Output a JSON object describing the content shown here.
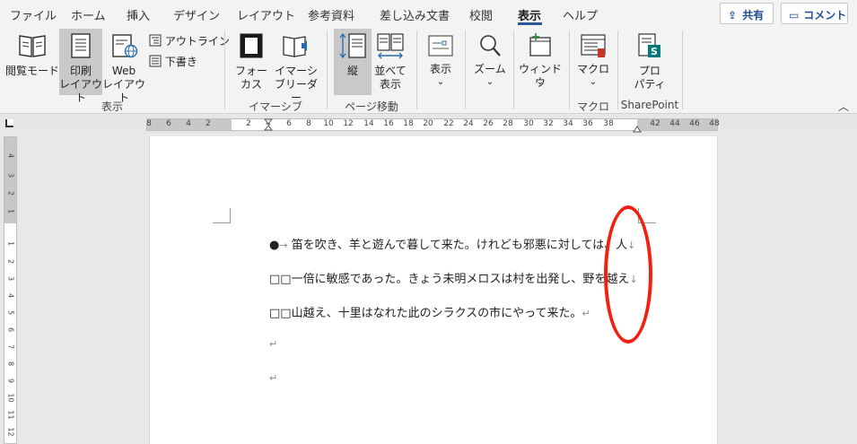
{
  "menu": {
    "tabs": [
      "ファイル",
      "ホーム",
      "挿入",
      "デザイン",
      "レイアウト",
      "参考資料",
      "差し込み文書",
      "校閲",
      "表示",
      "ヘルプ"
    ],
    "active_tab": "表示",
    "share_label": "共有",
    "comment_label": "コメント"
  },
  "ribbon": {
    "views": {
      "read_mode": "閲覧モード",
      "print_layout_1": "印刷",
      "print_layout_2": "レイアウト",
      "web_layout_1": "Web",
      "web_layout_2": "レイアウト",
      "outline": "アウトライン",
      "draft": "下書き",
      "group_label": "表示"
    },
    "immersive": {
      "focus_1": "フォー",
      "focus_2": "カス",
      "reader_1": "イマーシ",
      "reader_2": "ブリーダー",
      "group_label": "イマーシブ"
    },
    "page_movement": {
      "vertical": "縦",
      "side_1": "並べて",
      "side_2": "表示",
      "group_label": "ページ移動"
    },
    "show": {
      "label": "表示"
    },
    "zoom": {
      "label": "ズーム"
    },
    "window": {
      "label": "ウィンドウ"
    },
    "macro": {
      "label": "マクロ",
      "group_label": "マクロ"
    },
    "sharepoint": {
      "label_1": "プロ",
      "label_2": "パティ",
      "group_label": "SharePoint"
    }
  },
  "ruler": {
    "h_left": [
      "8",
      "6",
      "4",
      "2"
    ],
    "h_right": [
      "2",
      "4",
      "6",
      "8",
      "10",
      "12",
      "14",
      "16",
      "18",
      "20",
      "22",
      "24",
      "26",
      "28",
      "30",
      "32",
      "34",
      "36",
      "38"
    ],
    "h_far": [
      "42",
      "44",
      "46",
      "48"
    ],
    "v_top": [
      "4",
      "3",
      "2",
      "1"
    ],
    "v_body": [
      "1",
      "2",
      "3",
      "4",
      "5",
      "6",
      "7",
      "8",
      "9",
      "10",
      "11",
      "12"
    ]
  },
  "document": {
    "bullet": "●",
    "arrow": "→",
    "line1": "笛を吹き、羊と遊んで暮して来た。けれども邪悪に対しては、人",
    "line2": "□□一倍に敏感であった。きょう未明メロスは村を出発し、野を越え",
    "line3": "□□山越え、十里はなれた此のシラクスの市にやって来た。",
    "line_break_mark": "↓",
    "paragraph_mark": "↵"
  },
  "colors": {
    "accent": "#2b579a",
    "annotation": "#f2200f"
  }
}
